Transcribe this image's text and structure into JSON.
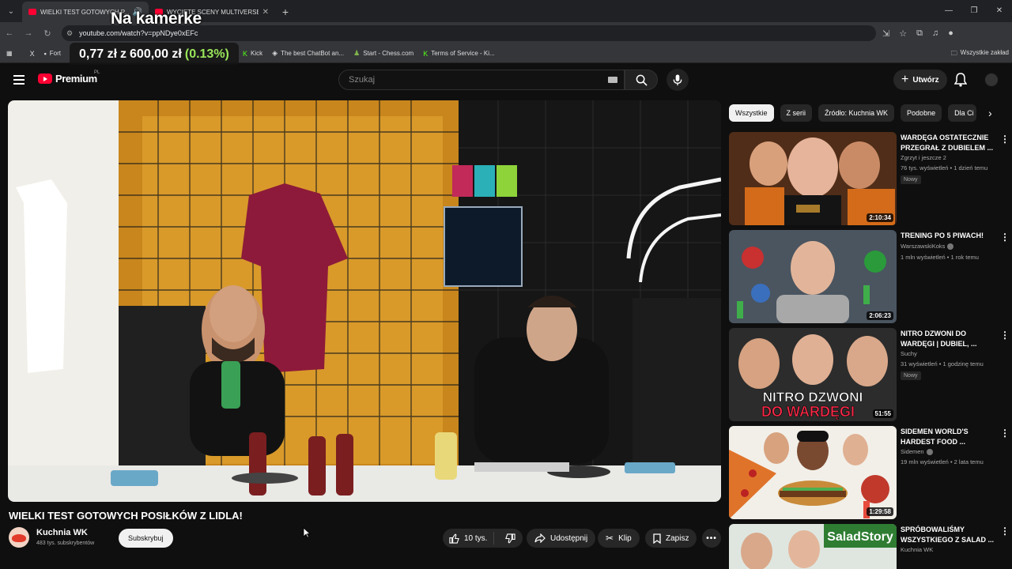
{
  "browser": {
    "tabs": [
      {
        "title": "WIELKI TEST GOTOWYCH P..."
      },
      {
        "title": "WYCIĘTE SCENY MULTIVERSE ("
      }
    ],
    "url": "youtube.com/watch?v=ppNDye0xEFc",
    "bookmarks": [
      {
        "label": "X",
        "icon": "x-icon"
      },
      {
        "label": "Fort",
        "icon": "bookmark-icon"
      },
      {
        "label": "Kick",
        "icon": "kick-icon"
      },
      {
        "label": "The best ChatBot an...",
        "icon": "chatbot-icon"
      },
      {
        "label": "Start - Chess.com",
        "icon": "chess-icon"
      },
      {
        "label": "Terms of Service - Ki...",
        "icon": "kick-icon"
      }
    ],
    "all_bookmarks": "Wszystkie zakład"
  },
  "overlay": {
    "title": "Na kamerke",
    "ticker_part1": "0,77 zł",
    "ticker_z": "z",
    "ticker_part2": "600,00 zł",
    "ticker_pct": "(0.13%)"
  },
  "youtube": {
    "brand": "Premium",
    "brand_region": "PL",
    "search_placeholder": "Szukaj",
    "create_label": "Utwórz"
  },
  "video": {
    "title": "WIELKI TEST GOTOWYCH POSIŁKÓW Z LIDLA!",
    "channel": "Kuchnia WK",
    "subscribers": "483 tys. subskrybentów",
    "subscribe_label": "Subskrybuj",
    "likes": "10 tys.",
    "share_label": "Udostępnij",
    "clip_label": "Klip",
    "save_label": "Zapisz"
  },
  "chips": [
    "Wszystkie",
    "Z serii",
    "Źródło: Kuchnia WK",
    "Podobne",
    "Dla Ci"
  ],
  "recommendations": [
    {
      "title": "WARDĘGA OSTATECZNIE PRZEGRAŁ Z DUBIELEM ...",
      "channel": "Zgrzyt i jeszcze 2",
      "meta": "76 tys. wyświetleń • 1 dzień temu",
      "badge": "Nowy",
      "duration": "2:10:34",
      "verified": false
    },
    {
      "title": "TRENING PO 5 PIWACH!",
      "channel": "WarszawskiKoks",
      "meta": "1 mln wyświetleń • 1 rok temu",
      "badge": "",
      "duration": "2:06:23",
      "verified": true
    },
    {
      "title": "NITRO DZWONI DO WARDĘGI | DUBIEL, ...",
      "channel": "Suchy",
      "meta": "31 wyświetleń • 1 godzinę temu",
      "badge": "Nowy",
      "duration": "51:55",
      "verified": false,
      "thumb_text_1": "NITRO DZWONI",
      "thumb_text_2": "DO WARDĘGI"
    },
    {
      "title": "SIDEMEN WORLD'S HARDEST FOOD ...",
      "channel": "Sidemen",
      "meta": "19 mln wyświetleń • 2 lata temu",
      "badge": "",
      "duration": "1:29:58",
      "verified": true
    },
    {
      "title": "SPRÓBOWALIŚMY WSZYSTKIEGO Z SALAD ...",
      "channel": "Kuchnia WK",
      "meta": "",
      "badge": "",
      "duration": "",
      "verified": false,
      "thumb_text_1": "SaladStory"
    }
  ]
}
